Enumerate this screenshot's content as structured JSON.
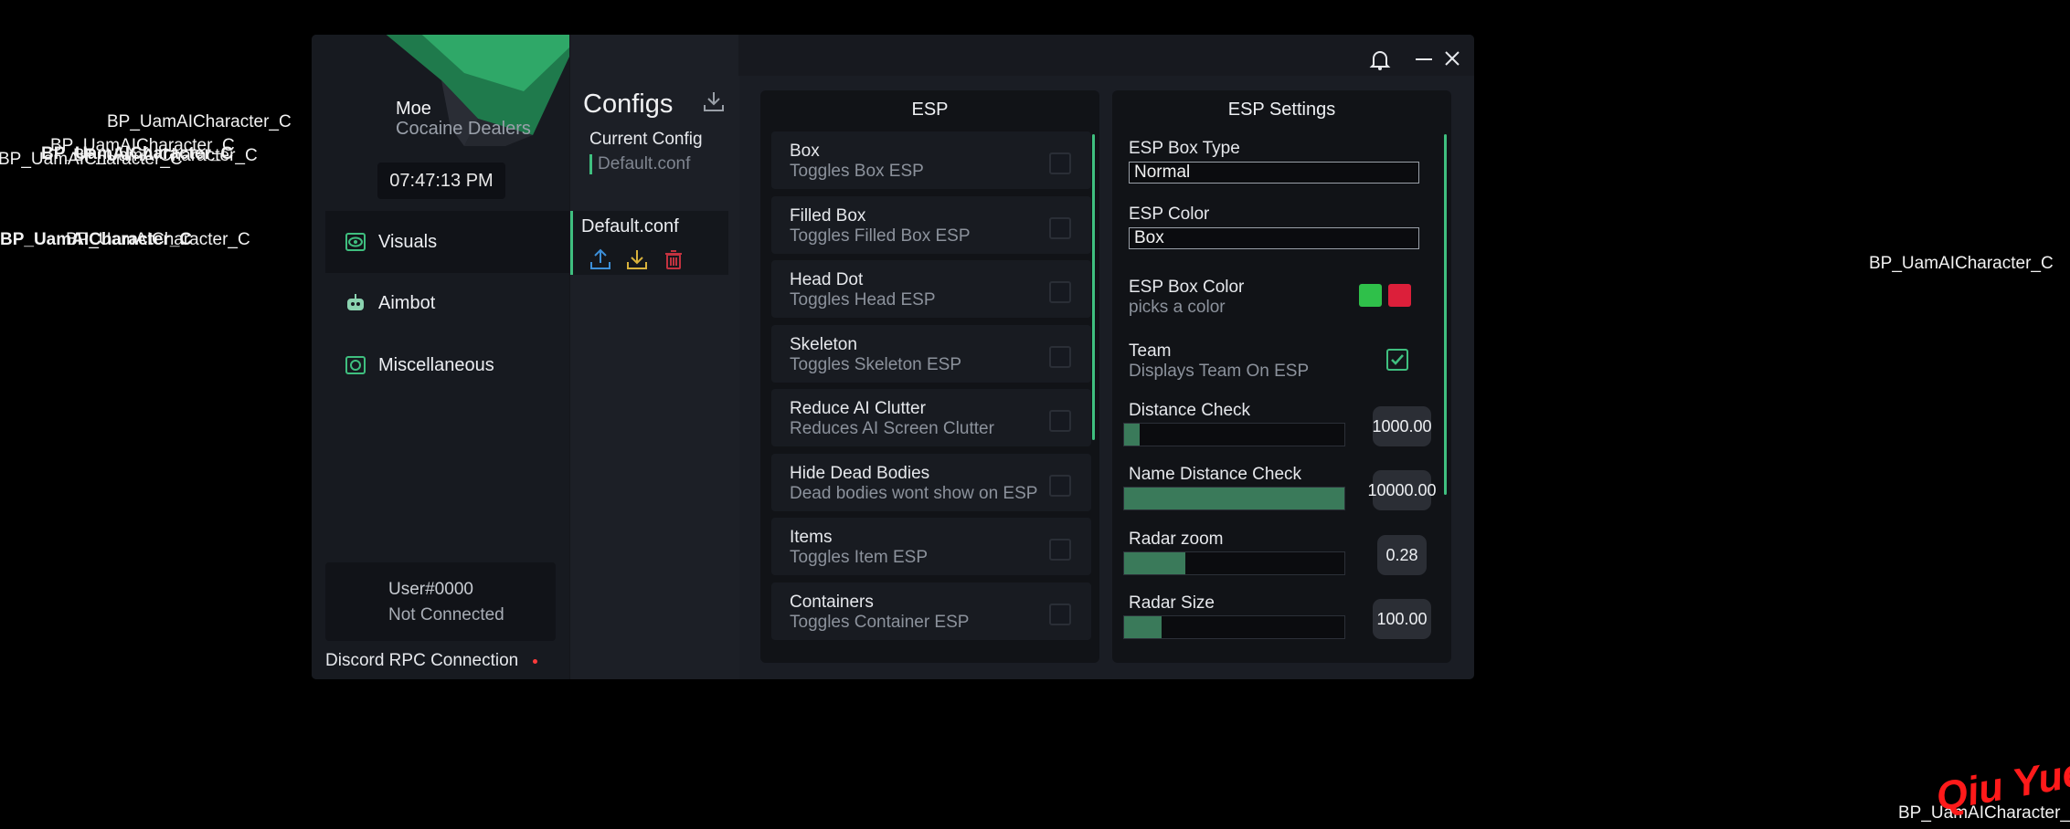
{
  "world_labels": [
    {
      "text": "BP_UamAICharacter_C"
    },
    {
      "text": "BP_UamAICharacter_C"
    },
    {
      "text": "BP_UamAICharacter_C"
    },
    {
      "text": "BP_UamAICharacter_C"
    },
    {
      "text": "BP_UamAICharacter_C"
    },
    {
      "text": "BP_UamAICharacter_C"
    },
    {
      "text": "BP_UamAICharacter_C"
    },
    {
      "text": "BP_UamAICharacter_C"
    },
    {
      "text": "BP_UamAICharacter_C"
    }
  ],
  "watermark": "Qiu Yue",
  "profile": {
    "name": "Moe",
    "subtitle": "Cocaine Dealers",
    "clock": "07:47:13 PM"
  },
  "nav": [
    {
      "label": "Visuals",
      "icon": "eye-icon",
      "active": true
    },
    {
      "label": "Aimbot",
      "icon": "robot-icon",
      "active": false
    },
    {
      "label": "Miscellaneous",
      "icon": "gear-icon",
      "active": false
    }
  ],
  "user": {
    "name": "User#0000",
    "status": "Not Connected"
  },
  "rpc": {
    "label": "Discord RPC Connection",
    "status_color": "#ff3b3b"
  },
  "configs": {
    "title": "Configs",
    "current_label": "Current Config",
    "current_value": "Default.conf",
    "items": [
      {
        "label": "Default.conf"
      }
    ],
    "actions": [
      "upload-icon",
      "download-icon",
      "trash-icon"
    ]
  },
  "esp": {
    "title": "ESP",
    "rows": [
      {
        "label": "Box",
        "desc": "Toggles Box ESP",
        "checked": false
      },
      {
        "label": "Filled Box",
        "desc": "Toggles Filled Box ESP",
        "checked": false
      },
      {
        "label": "Head Dot",
        "desc": "Toggles Head ESP",
        "checked": false
      },
      {
        "label": "Skeleton",
        "desc": "Toggles Skeleton ESP",
        "checked": false
      },
      {
        "label": "Reduce AI Clutter",
        "desc": "Reduces AI Screen Clutter",
        "checked": false
      },
      {
        "label": "Hide Dead Bodies",
        "desc": "Dead bodies wont show on ESP",
        "checked": false
      },
      {
        "label": "Items",
        "desc": "Toggles Item ESP",
        "checked": false
      },
      {
        "label": "Containers",
        "desc": "Toggles Container ESP",
        "checked": false
      }
    ]
  },
  "esp_settings": {
    "title": "ESP Settings",
    "box_type": {
      "label": "ESP Box Type",
      "value": "Normal"
    },
    "color": {
      "label": "ESP Color",
      "value": "Box"
    },
    "box_color": {
      "label": "ESP Box Color",
      "desc": "picks a color",
      "swatches": [
        "#2fc04a",
        "#dc1f3a"
      ]
    },
    "team": {
      "label": "Team",
      "desc": "Displays Team On ESP",
      "checked": true
    },
    "sliders": [
      {
        "label": "Distance Check",
        "value": "1000.00",
        "fraction": 0.07
      },
      {
        "label": "Name Distance Check",
        "value": "10000.00",
        "fraction": 1.0
      },
      {
        "label": "Radar zoom",
        "value": "0.28",
        "fraction": 0.28
      },
      {
        "label": "Radar Size",
        "value": "100.00",
        "fraction": 0.17
      }
    ]
  },
  "colors": {
    "accent": "#3fbf7f",
    "window_bg": "#1a1d24",
    "panel_bg": "#111317"
  }
}
